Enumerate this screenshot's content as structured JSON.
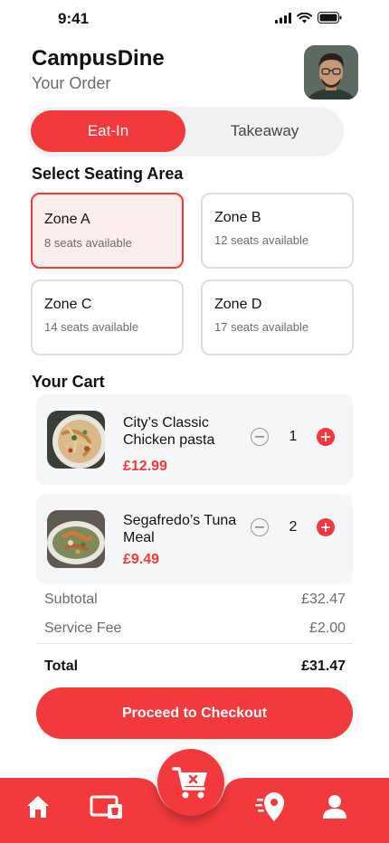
{
  "status": {
    "time": "9:41"
  },
  "header": {
    "title": "CampusDine",
    "subtitle": "Your Order"
  },
  "order_type": {
    "options": [
      "Eat-In",
      "Takeaway"
    ],
    "selected": "Eat-In"
  },
  "seating": {
    "title": "Select Seating Area",
    "zones": [
      {
        "name": "Zone A",
        "seats": "8 seats available",
        "selected": true
      },
      {
        "name": "Zone B",
        "seats": "12 seats available",
        "selected": false
      },
      {
        "name": "Zone C",
        "seats": "14 seats available",
        "selected": false
      },
      {
        "name": "Zone D",
        "seats": "17 seats available",
        "selected": false
      }
    ]
  },
  "cart": {
    "title": "Your Cart",
    "items": [
      {
        "name_line1": "City’s Classic",
        "name_line2": "Chicken pasta",
        "price": "£12.99",
        "qty": "1"
      },
      {
        "name_line1": "Segafredo’s Tuna",
        "name_line2": "Meal",
        "price": "£9.49",
        "qty": "2"
      }
    ]
  },
  "summary": {
    "subtotal_label": "Subtotal",
    "subtotal": "£32.47",
    "fee_label": "Service Fee",
    "fee": "£2.00",
    "total_label": "Total",
    "total": "£31.47"
  },
  "checkout": {
    "label": "Proceed to Checkout"
  },
  "nav": {
    "items": [
      "home-icon",
      "wallet-icon",
      "cart-icon",
      "location-icon",
      "profile-icon"
    ]
  },
  "colors": {
    "accent": "#f23a3c",
    "selected_bg": "#fdeeee",
    "card_bg": "#f5f6f8",
    "muted": "#6b6b6b"
  }
}
